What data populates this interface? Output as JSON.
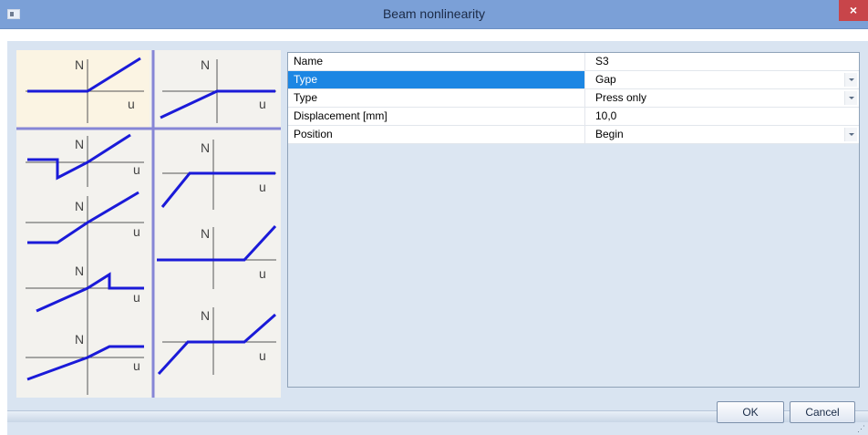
{
  "window": {
    "title": "Beam nonlinearity",
    "close_glyph": "×"
  },
  "diagrams": {
    "axis_n": "N",
    "axis_u": "u",
    "line_color": "#1a1ad8",
    "highlight_color": "#fbf4e3",
    "separator_color": "#8686d6"
  },
  "properties": {
    "rows": [
      {
        "name": "Name",
        "value": "S3",
        "dropdown": false,
        "selected": false
      },
      {
        "name": "Type",
        "value": "Gap",
        "dropdown": true,
        "selected": true
      },
      {
        "name": "Type",
        "value": "Press only",
        "dropdown": true,
        "selected": false
      },
      {
        "name": "Displacement [mm]",
        "value": "10,0",
        "dropdown": false,
        "selected": false
      },
      {
        "name": "Position",
        "value": "Begin",
        "dropdown": true,
        "selected": false
      }
    ]
  },
  "buttons": {
    "ok": "OK",
    "cancel": "Cancel"
  },
  "colors": {
    "titlebar": "#7ba0d7",
    "close": "#c8454a",
    "selection": "#1c86e3"
  }
}
